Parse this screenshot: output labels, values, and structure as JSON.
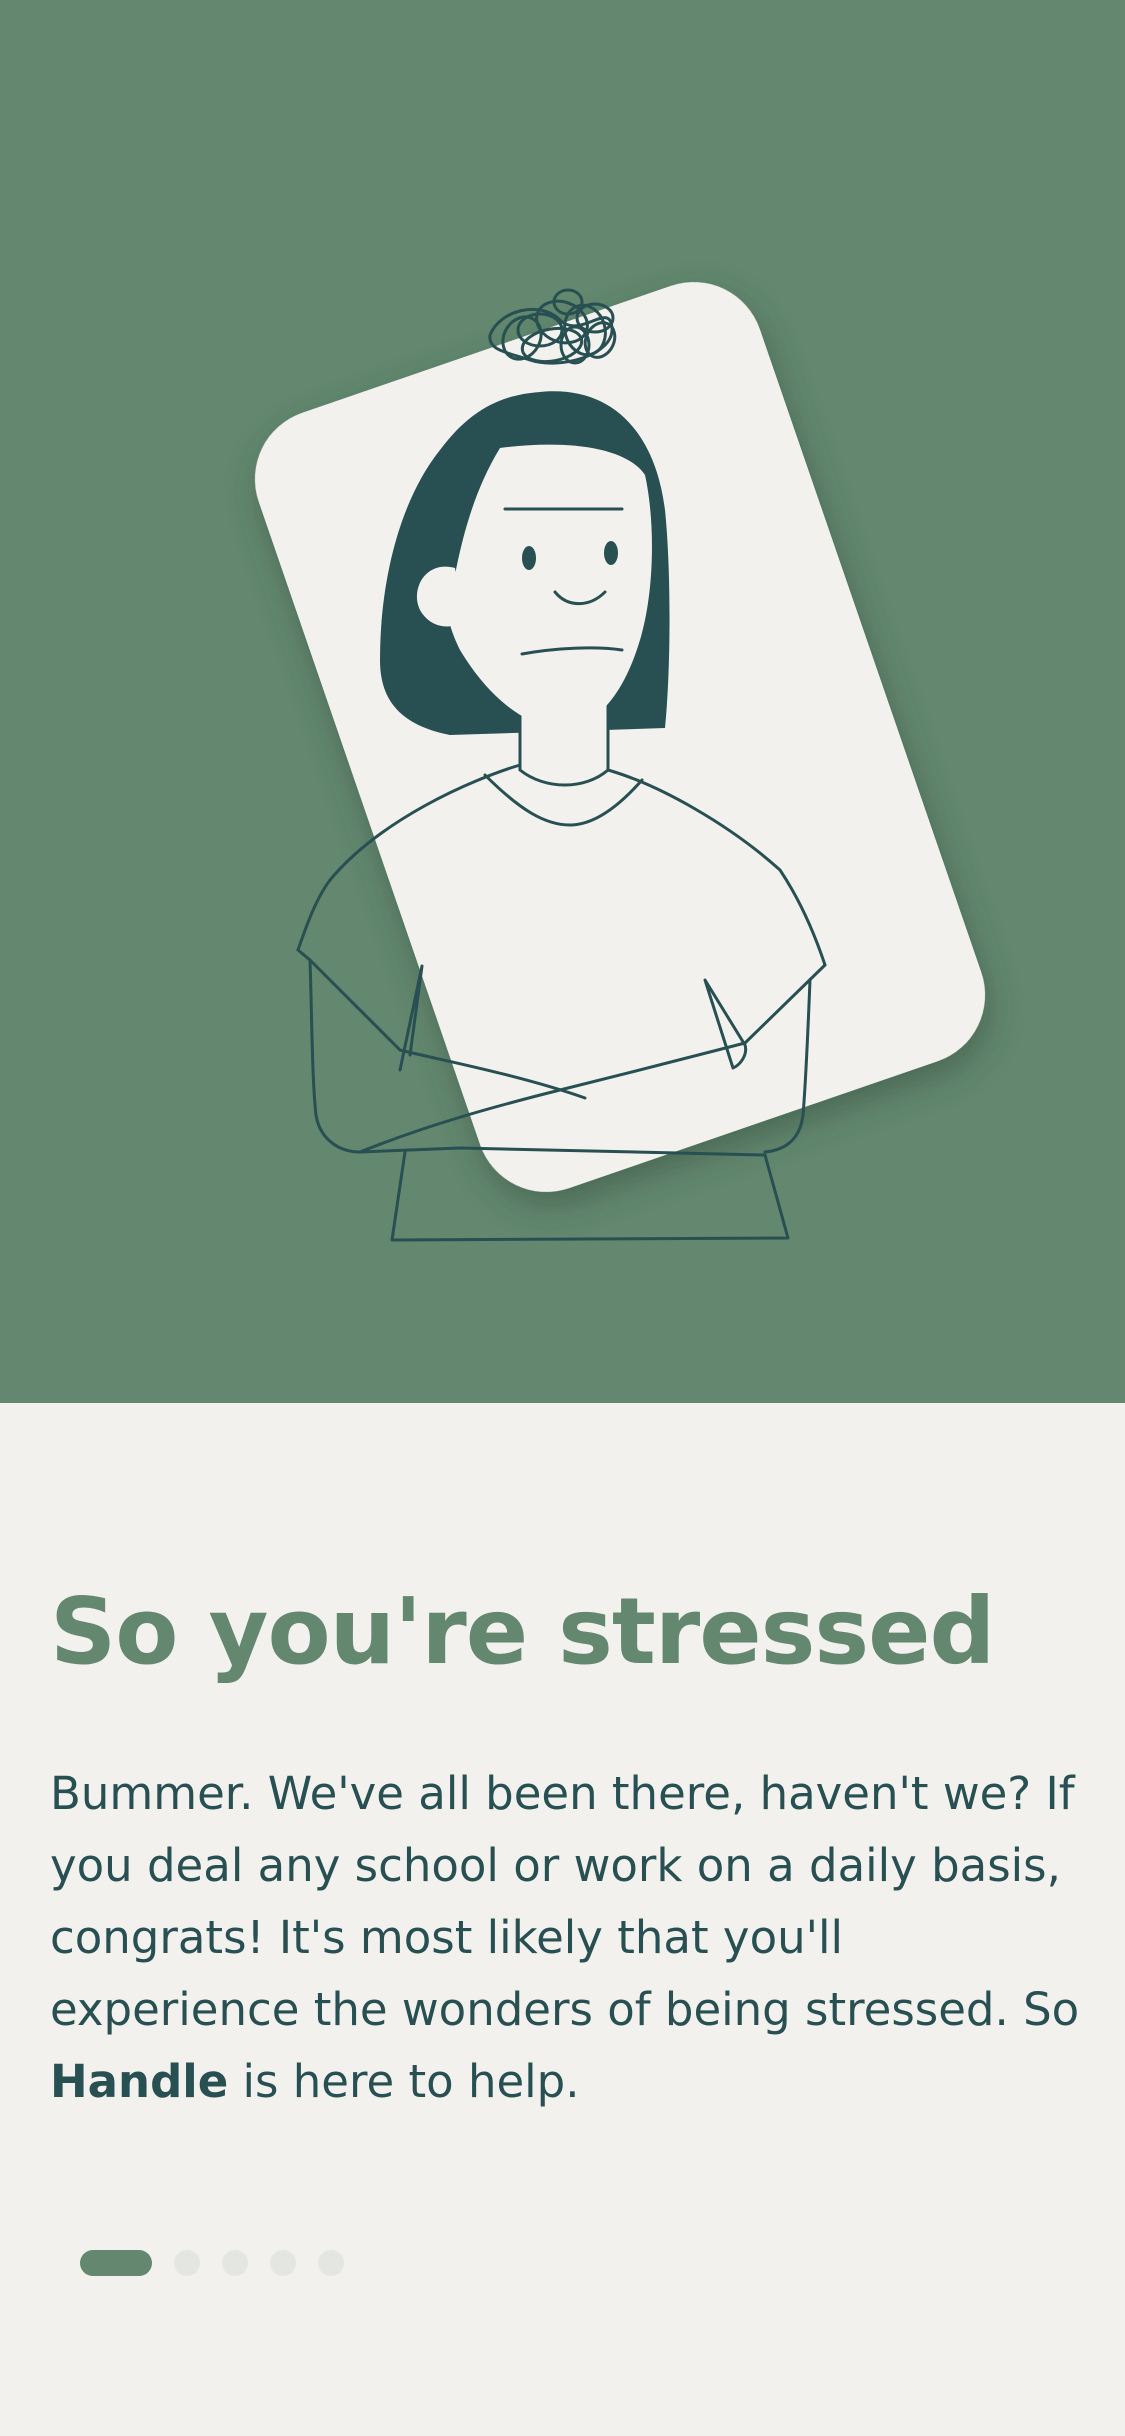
{
  "onboarding": {
    "illustration": {
      "subject": "stressed-person-illustration",
      "icon": "tangled-scribble-icon"
    },
    "title": "So you're stressed",
    "body_before_brand": "Bummer. We've all been there, haven't we? If you deal any school or work on a daily basis, congrats! It's most likely that you'll experience the wonders of being stressed. So ",
    "brand": "Handle",
    "body_after_brand": " is here to help.",
    "pager": {
      "total_pages": 5,
      "current_page": 1
    }
  },
  "colors": {
    "hero_background": "#63876f",
    "screen_background": "#f2f1ee",
    "card": "#f2f1ee",
    "ink": "#285052",
    "title": "#63876f",
    "pager_active": "#63876f",
    "pager_inactive": "#e3e6e1"
  }
}
